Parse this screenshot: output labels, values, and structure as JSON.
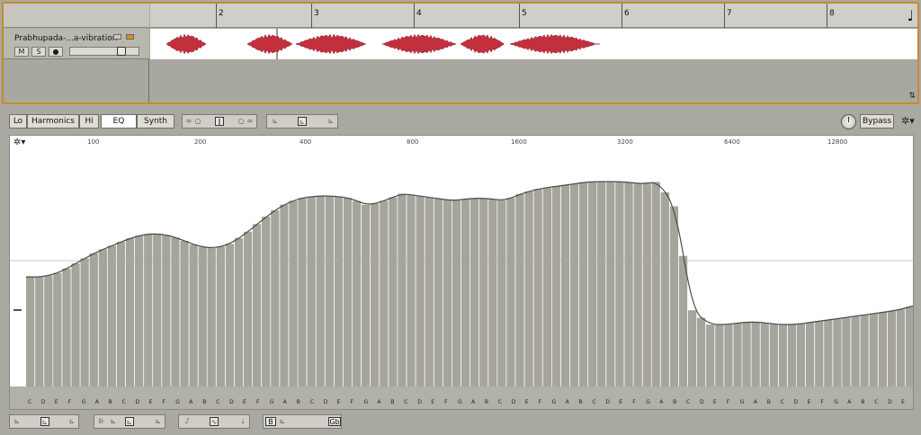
{
  "arrange": {
    "track_name": "Prabhupada-...a-vibration",
    "mute_label": "M",
    "solo_label": "S",
    "rec_label": "●",
    "bar_numbers": [
      "2",
      "3",
      "4",
      "5",
      "6",
      "7",
      "8"
    ]
  },
  "toolbar": {
    "lo_label": "Lo",
    "harmonics_label": "Harmonics",
    "hi_label": "Hi",
    "eq_label": "EQ",
    "synth_label": "Synth",
    "bypass_label": "Bypass"
  },
  "eq": {
    "freq_labels": [
      "100",
      "200",
      "400",
      "800",
      "1600",
      "3200",
      "6400",
      "12800"
    ],
    "note_labels": [
      "C",
      "D",
      "E",
      "F",
      "G",
      "A",
      "B",
      "C",
      "D",
      "E",
      "F",
      "G",
      "A",
      "B",
      "C",
      "D",
      "E",
      "F",
      "G",
      "A",
      "B",
      "C",
      "D",
      "E",
      "F",
      "G",
      "A",
      "B",
      "C",
      "D",
      "E",
      "F",
      "G",
      "A",
      "B",
      "C",
      "D",
      "E",
      "F",
      "G",
      "A",
      "B",
      "C",
      "D",
      "E",
      "F",
      "G",
      "A",
      "B",
      "C",
      "D",
      "E",
      "F",
      "G",
      "A",
      "B",
      "C",
      "D",
      "E",
      "F",
      "G",
      "A",
      "B",
      "C",
      "D",
      "E"
    ],
    "curve": [
      0.46,
      0.46,
      0.48,
      0.52,
      0.56,
      0.59,
      0.62,
      0.64,
      0.64,
      0.62,
      0.59,
      0.58,
      0.6,
      0.65,
      0.71,
      0.76,
      0.79,
      0.8,
      0.8,
      0.79,
      0.76,
      0.78,
      0.81,
      0.8,
      0.79,
      0.78,
      0.79,
      0.79,
      0.78,
      0.81,
      0.83,
      0.84,
      0.85,
      0.86,
      0.86,
      0.86,
      0.85,
      0.86,
      0.75,
      0.32,
      0.26,
      0.26,
      0.27,
      0.27,
      0.26,
      0.26,
      0.27,
      0.28,
      0.29,
      0.3,
      0.31,
      0.32,
      0.34
    ]
  },
  "bottom": {
    "b_label": "B",
    "gb_label": "Gb"
  }
}
